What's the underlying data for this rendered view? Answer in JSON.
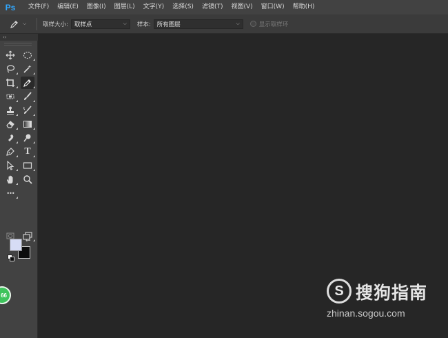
{
  "app": {
    "logo_text": "Ps"
  },
  "menu": {
    "items": [
      {
        "label": "文件(F)"
      },
      {
        "label": "编辑(E)"
      },
      {
        "label": "图像(I)"
      },
      {
        "label": "图层(L)"
      },
      {
        "label": "文字(Y)"
      },
      {
        "label": "选择(S)"
      },
      {
        "label": "滤镜(T)"
      },
      {
        "label": "视图(V)"
      },
      {
        "label": "窗口(W)"
      },
      {
        "label": "帮助(H)"
      }
    ]
  },
  "options_bar": {
    "current_tool_icon": "eyedropper-icon",
    "sample_size_label": "取样大小:",
    "sample_size_value": "取样点",
    "sample_label": "样本:",
    "sample_value": "所有图层",
    "show_ring_label": "显示取样环",
    "show_ring_checked": false
  },
  "toolbar": {
    "collapse_glyph": "‹‹",
    "active_tool": "eyedropper",
    "tools": [
      [
        "move-tool",
        "marquee-tool"
      ],
      [
        "lasso-tool",
        "magic-wand-tool"
      ],
      [
        "crop-tool",
        "eyedropper-tool"
      ],
      [
        "spot-healing-tool",
        "brush-tool"
      ],
      [
        "clone-stamp-tool",
        "history-brush-tool"
      ],
      [
        "eraser-tool",
        "gradient-tool"
      ],
      [
        "blur-tool",
        "dodge-tool"
      ],
      [
        "pen-tool",
        "type-tool"
      ],
      [
        "path-selection-tool",
        "rectangle-tool"
      ],
      [
        "hand-tool",
        "zoom-tool"
      ],
      [
        "edit-toolbar"
      ]
    ],
    "type_tool_glyph": "T",
    "more_glyph": "•••",
    "foreground_color": "#d6dcf5",
    "background_color": "#0d0d0d",
    "swap_glyph": "⇄"
  },
  "badge": {
    "text": "66"
  },
  "watermark": {
    "logo_letter": "S",
    "title": "搜狗指南",
    "url": "zhinan.sogou.com"
  }
}
